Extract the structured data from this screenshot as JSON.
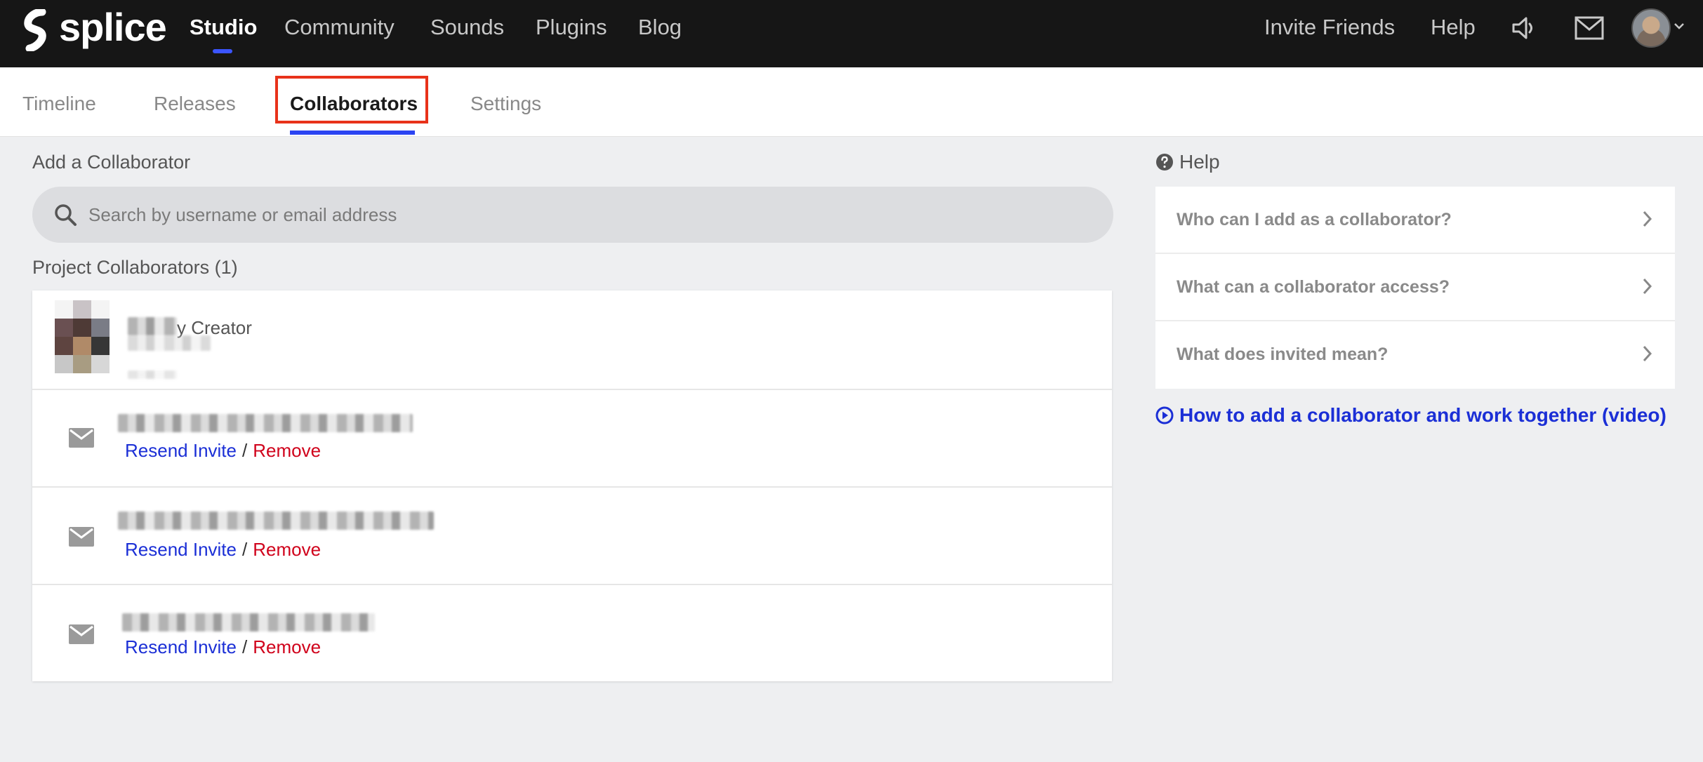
{
  "brand": {
    "name": "splice"
  },
  "topnav": {
    "items": [
      {
        "label": "Studio",
        "active": true
      },
      {
        "label": "Community"
      },
      {
        "label": "Sounds"
      },
      {
        "label": "Plugins"
      },
      {
        "label": "Blog"
      }
    ],
    "right": {
      "invite": "Invite Friends",
      "help": "Help",
      "icons": [
        "speaker-icon",
        "mail-icon",
        "avatar",
        "chevron-down-icon"
      ]
    }
  },
  "subtabs": [
    {
      "label": "Timeline"
    },
    {
      "label": "Releases"
    },
    {
      "label": "Collaborators",
      "active": true
    },
    {
      "label": "Settings"
    }
  ],
  "add_collaborator": {
    "title": "Add a Collaborator",
    "search_placeholder": "Search by username or email address"
  },
  "project_collaborators": {
    "title": "Project Collaborators (1)",
    "owner": {
      "name_visible": "y Creator"
    },
    "invites": [
      {
        "resend": "Resend Invite",
        "sep": "/",
        "remove": "Remove"
      },
      {
        "resend": "Resend Invite",
        "sep": "/",
        "remove": "Remove"
      },
      {
        "resend": "Resend Invite",
        "sep": "/",
        "remove": "Remove"
      }
    ]
  },
  "help": {
    "title": "Help",
    "items": [
      {
        "question": "Who can I add as a collaborator?"
      },
      {
        "question": "What can a collaborator access?"
      },
      {
        "question": "What does invited mean?"
      }
    ],
    "video_link": "How to add a collaborator and work together (video)"
  },
  "colors": {
    "topbar": "#161616",
    "accent_blue": "#2b44f2",
    "link_blue": "#1b2fd6",
    "remove_red": "#d0021b",
    "highlight_red": "#e8321a"
  }
}
